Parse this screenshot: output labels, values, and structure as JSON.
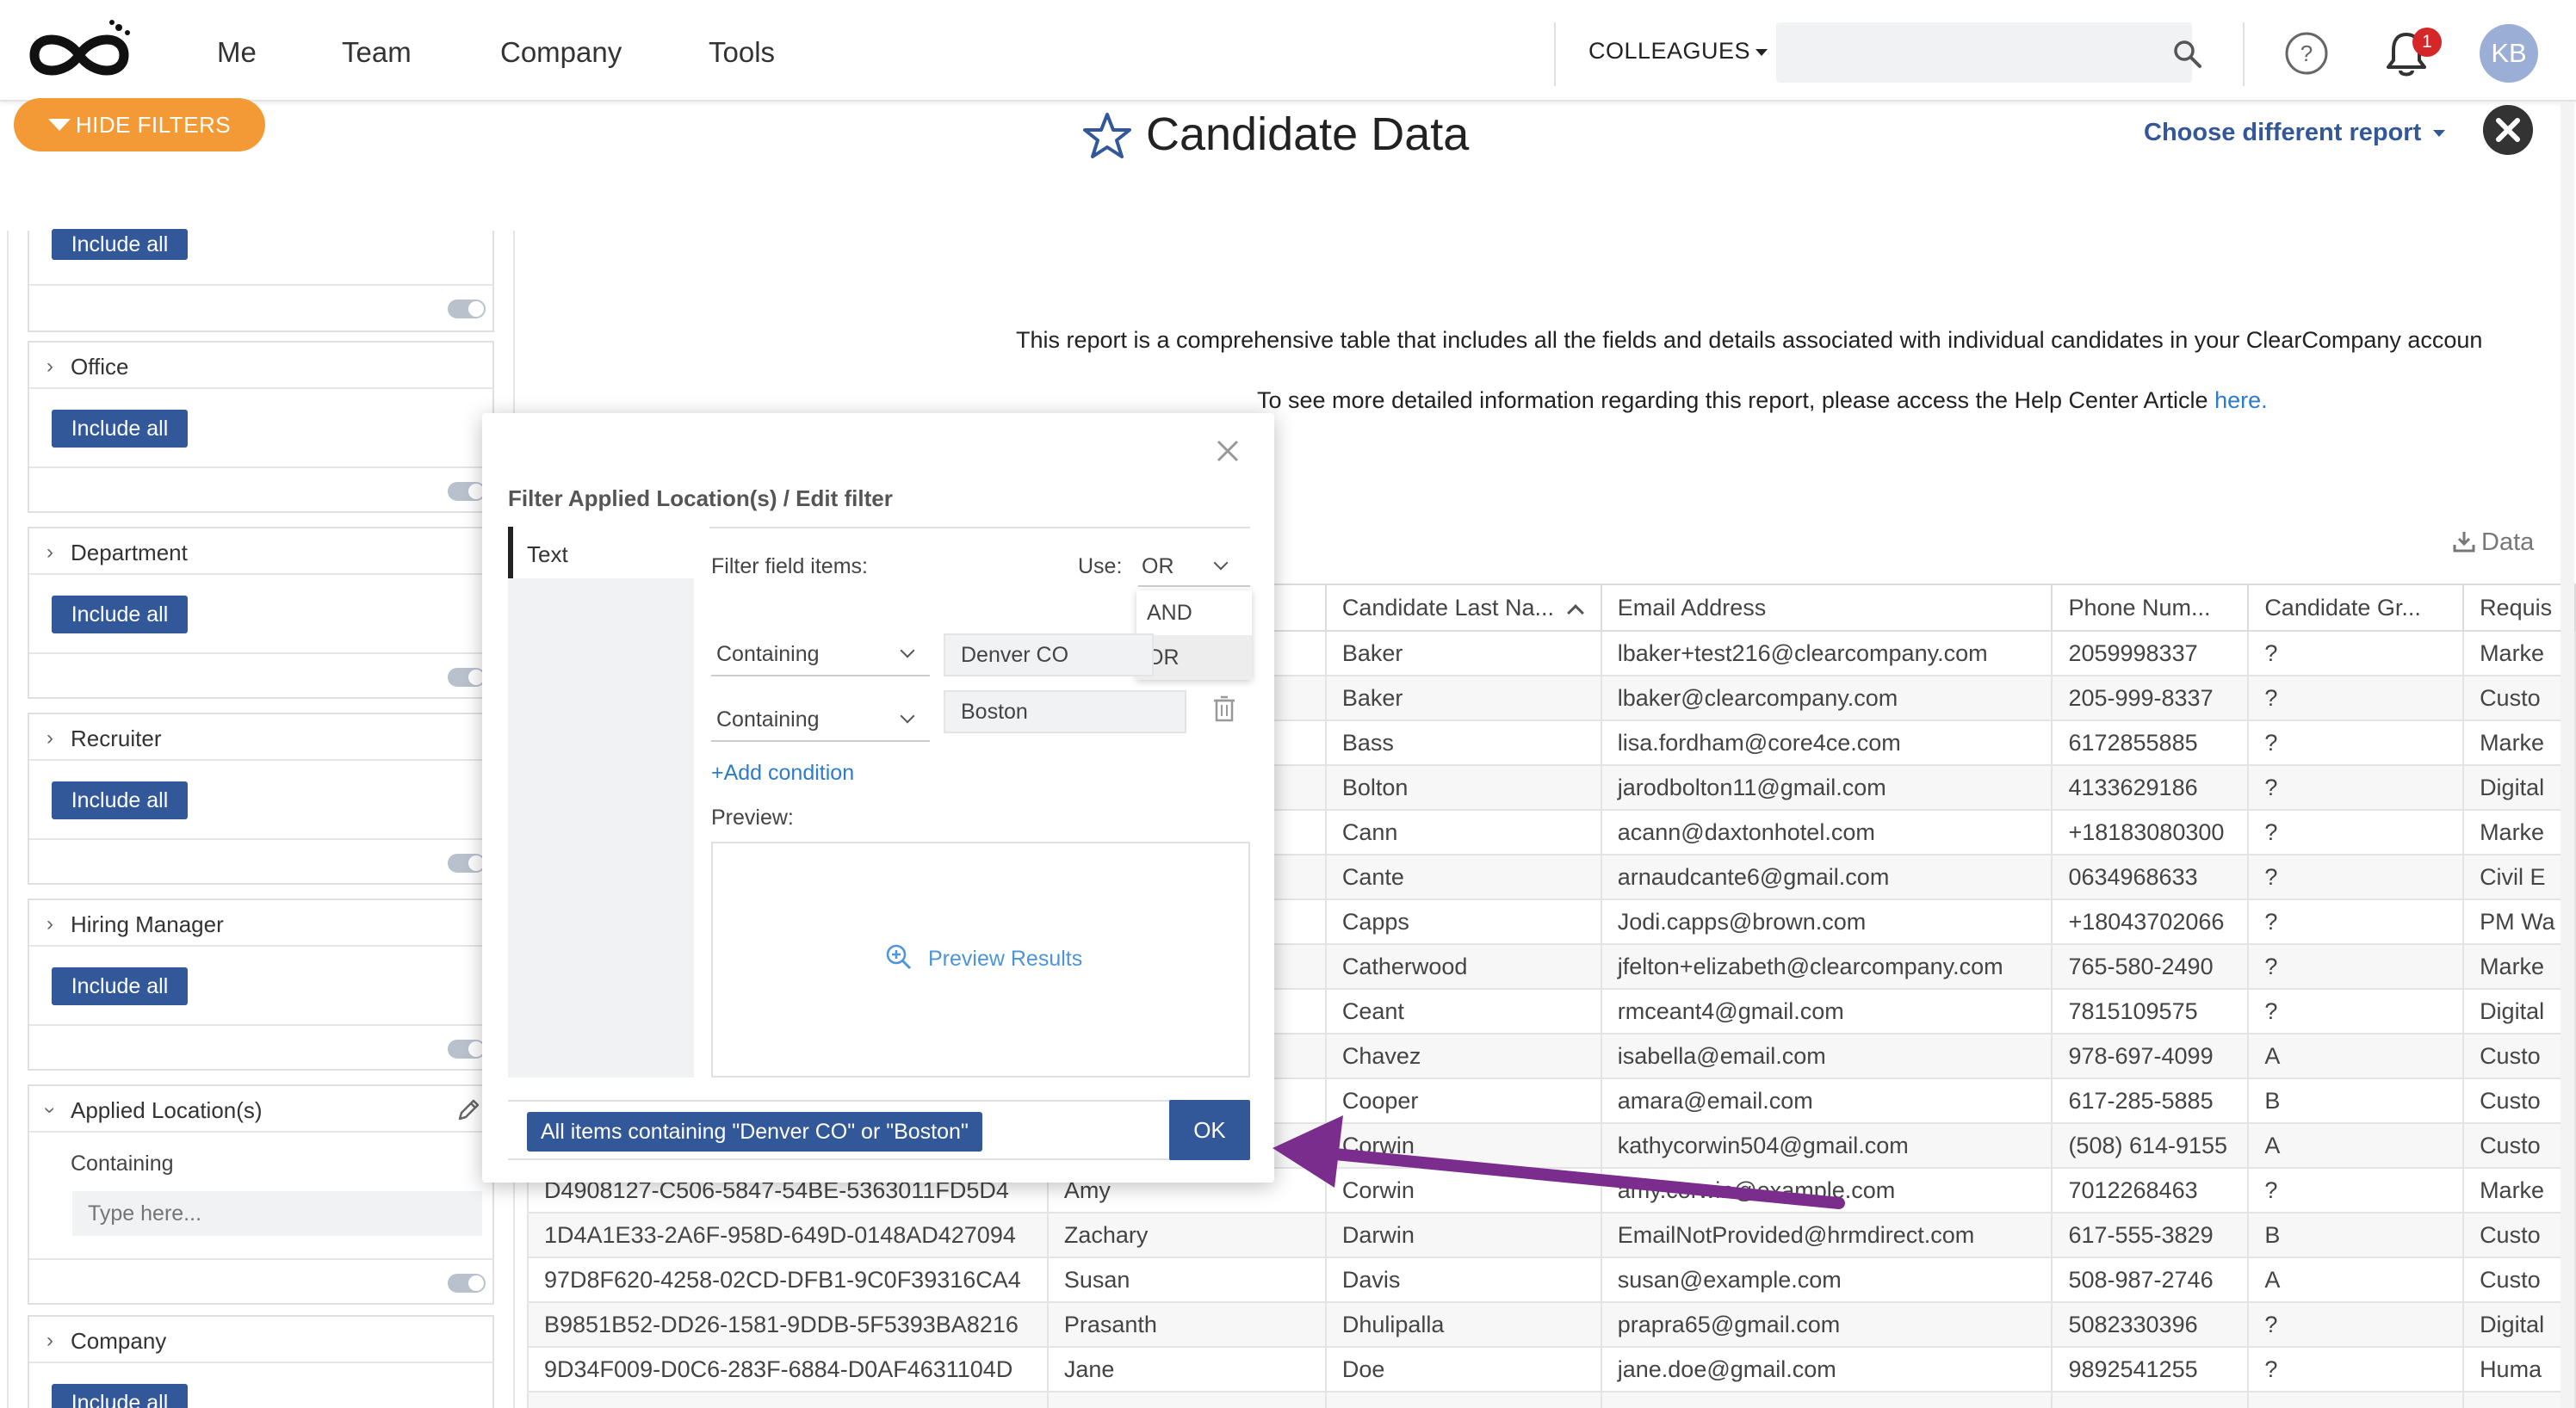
{
  "nav": {
    "links": [
      "Me",
      "Team",
      "Company",
      "Tools"
    ],
    "colleagues_label": "COLLEAGUES",
    "search_placeholder": "",
    "notification_count": "1",
    "avatar_initials": "KB"
  },
  "header": {
    "hide_filters_label": "HIDE FILTERS",
    "title": "Candidate Data",
    "choose_report_label": "Choose different report"
  },
  "description": {
    "line1": "This report is a comprehensive table that includes all the fields and details associated with individual candidates in your ClearCompany accoun",
    "line2_prefix": "To see more detailed information regarding this report, please access the Help Center Article ",
    "line2_link": "here."
  },
  "filters": {
    "include_all_label": "Include all",
    "office": "Office",
    "department": "Department",
    "recruiter": "Recruiter",
    "hiring_manager": "Hiring Manager",
    "applied_location": "Applied Location(s)",
    "containing": "Containing",
    "type_here_placeholder": "Type here...",
    "company": "Company"
  },
  "table": {
    "download_label": "Data",
    "headers": [
      "",
      "",
      "Candidate Last Na...",
      "Email Address",
      "Phone Num...",
      "Candidate Gr...",
      "Requis"
    ],
    "rows": [
      [
        "",
        "",
        "Baker",
        "lbaker+test216@clearcompany.com",
        "2059998337",
        "?",
        "Marke"
      ],
      [
        "",
        "",
        "Baker",
        "lbaker@clearcompany.com",
        "205-999-8337",
        "?",
        "Custo"
      ],
      [
        "",
        "",
        "Bass",
        "lisa.fordham@core4ce.com",
        "6172855885",
        "?",
        "Marke"
      ],
      [
        "",
        "",
        "Bolton",
        "jarodbolton11@gmail.com",
        "4133629186",
        "?",
        "Digital"
      ],
      [
        "",
        "",
        "Cann",
        "acann@daxtonhotel.com",
        "+18183080300",
        "?",
        "Marke"
      ],
      [
        "",
        "",
        "Cante",
        "arnaudcante6@gmail.com",
        "0634968633",
        "?",
        "Civil E"
      ],
      [
        "",
        "",
        "Capps",
        "Jodi.capps@brown.com",
        "+18043702066",
        "?",
        "PM Wa"
      ],
      [
        "",
        "",
        "Catherwood",
        "jfelton+elizabeth@clearcompany.com",
        "765-580-2490",
        "?",
        "Marke"
      ],
      [
        "",
        "",
        "Ceant",
        "rmceant4@gmail.com",
        "7815109575",
        "?",
        "Digital"
      ],
      [
        "",
        "",
        "Chavez",
        "isabella@email.com",
        "978-697-4099",
        "A",
        "Custo"
      ],
      [
        "",
        "",
        "Cooper",
        "amara@email.com",
        "617-285-5885",
        "B",
        "Custo"
      ],
      [
        "",
        "",
        "Corwin",
        "kathycorwin504@gmail.com",
        "(508) 614-9155",
        "A",
        "Custo"
      ],
      [
        "D4908127-C506-5847-54BE-5363011FD5D4",
        "Amy",
        "Corwin",
        "amy.corwin@example.com",
        "7012268463",
        "?",
        "Marke"
      ],
      [
        "1D4A1E33-2A6F-958D-649D-0148AD427094",
        "Zachary",
        "Darwin",
        "EmailNotProvided@hrmdirect.com",
        "617-555-3829",
        "B",
        "Custo"
      ],
      [
        "97D8F620-4258-02CD-DFB1-9C0F39316CA4",
        "Susan",
        "Davis",
        "susan@example.com",
        "508-987-2746",
        "A",
        "Custo"
      ],
      [
        "B9851B52-DD26-1581-9DDB-5F5393BA8216",
        "Prasanth",
        "Dhulipalla",
        "prapra65@gmail.com",
        "5082330396",
        "?",
        "Digital"
      ],
      [
        "9D34F009-D0C6-283F-6884-D0AF4631104D",
        "Jane",
        "Doe",
        "jane.doe@gmail.com",
        "9892541255",
        "?",
        "Huma"
      ],
      [
        "",
        "",
        "",
        "",
        "",
        "",
        ""
      ]
    ]
  },
  "modal": {
    "title": "Filter Applied Location(s) / Edit filter",
    "tab_label": "Text",
    "filter_field_items_label": "Filter field items:",
    "use_label": "Use:",
    "use_value": "OR",
    "use_options": [
      "AND",
      "OR"
    ],
    "conditions": [
      {
        "operator": "Containing",
        "value": "Denver CO"
      },
      {
        "operator": "Containing",
        "value": "Boston"
      }
    ],
    "add_condition_label": "+Add condition",
    "preview_label": "Preview:",
    "preview_results_label": "Preview Results",
    "summary": "All items containing \"Denver CO\" or \"Boston\"",
    "ok_label": "OK"
  },
  "colors": {
    "primary": "#33589a",
    "accent_orange": "#f39a36",
    "link_blue": "#2d7cc9",
    "annotation_arrow": "#7b2d8e",
    "badge_red": "#d62728"
  }
}
